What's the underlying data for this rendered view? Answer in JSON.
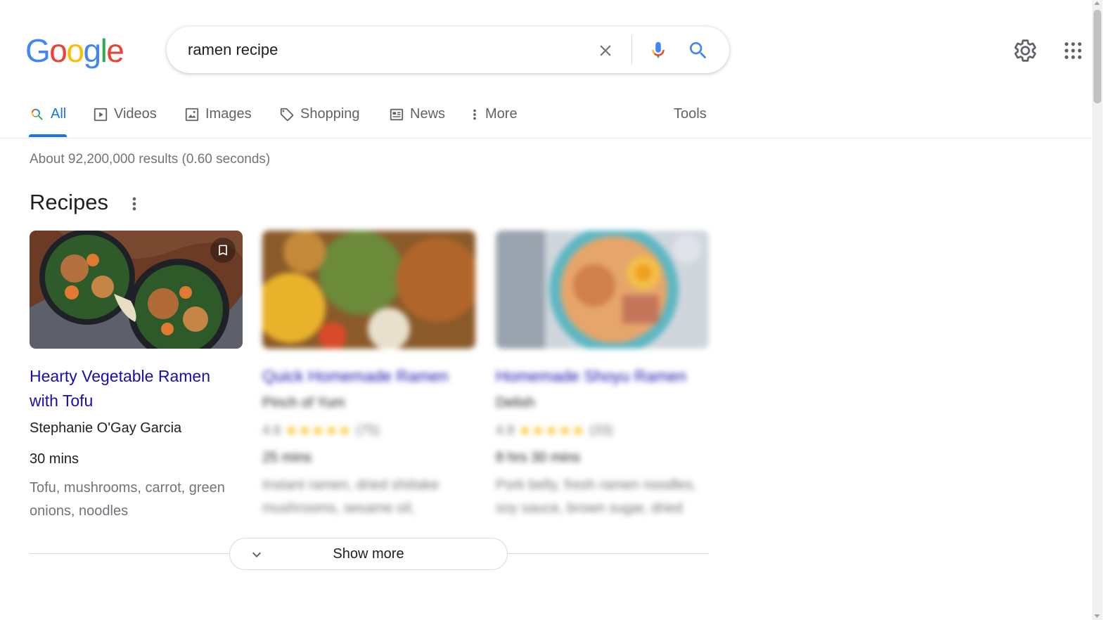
{
  "logo": {
    "letters": [
      "G",
      "o",
      "o",
      "g",
      "l",
      "e"
    ],
    "colors": [
      "#4285f4",
      "#ea4335",
      "#fbbc05",
      "#4285f4",
      "#34a853",
      "#ea4335"
    ]
  },
  "search": {
    "value": "ramen recipe",
    "placeholder": ""
  },
  "header_icons": {
    "clear": "close-icon",
    "mic": "mic-icon",
    "search": "search-icon",
    "settings": "gear-icon",
    "apps": "apps-grid-icon"
  },
  "tabs": [
    {
      "label": "All",
      "icon": "search-icon",
      "active": true
    },
    {
      "label": "Videos",
      "icon": "play-icon"
    },
    {
      "label": "Images",
      "icon": "image-icon"
    },
    {
      "label": "Shopping",
      "icon": "tag-icon"
    },
    {
      "label": "News",
      "icon": "news-icon"
    },
    {
      "label": "More",
      "icon": "more-vert-icon"
    }
  ],
  "tools_label": "Tools",
  "result_stats": "About 92,200,000 results (0.60 seconds)",
  "recipes": {
    "title": "Recipes",
    "cards": [
      {
        "title": "Hearty Vegetable Ramen with Tofu",
        "source": "Stephanie O'Gay Garcia",
        "time": "30 mins",
        "ingredients": "Tofu, mushrooms, carrot, green onions, noodles"
      },
      {
        "title": "Quick Homemade Ramen",
        "source": "Pinch of Yum",
        "rating": "4.6",
        "stars": "★★★★★",
        "reviews": "(75)",
        "time": "25 mins",
        "ingredients": "Instant ramen, dried shiitake mushrooms, sesame oil,"
      },
      {
        "title": "Homemade Shoyu Ramen",
        "source": "Delish",
        "rating": "4.8",
        "stars": "★★★★★",
        "reviews": "(33)",
        "time": "8 hrs 30 mins",
        "ingredients": "Pork belly, fresh ramen noodles, soy sauce, brown sugar, dried"
      }
    ],
    "show_more": "Show more"
  },
  "colors": {
    "link": "#1a0dab",
    "accent": "#1a73e8",
    "muted": "#70757a",
    "star": "#fbbc04"
  }
}
